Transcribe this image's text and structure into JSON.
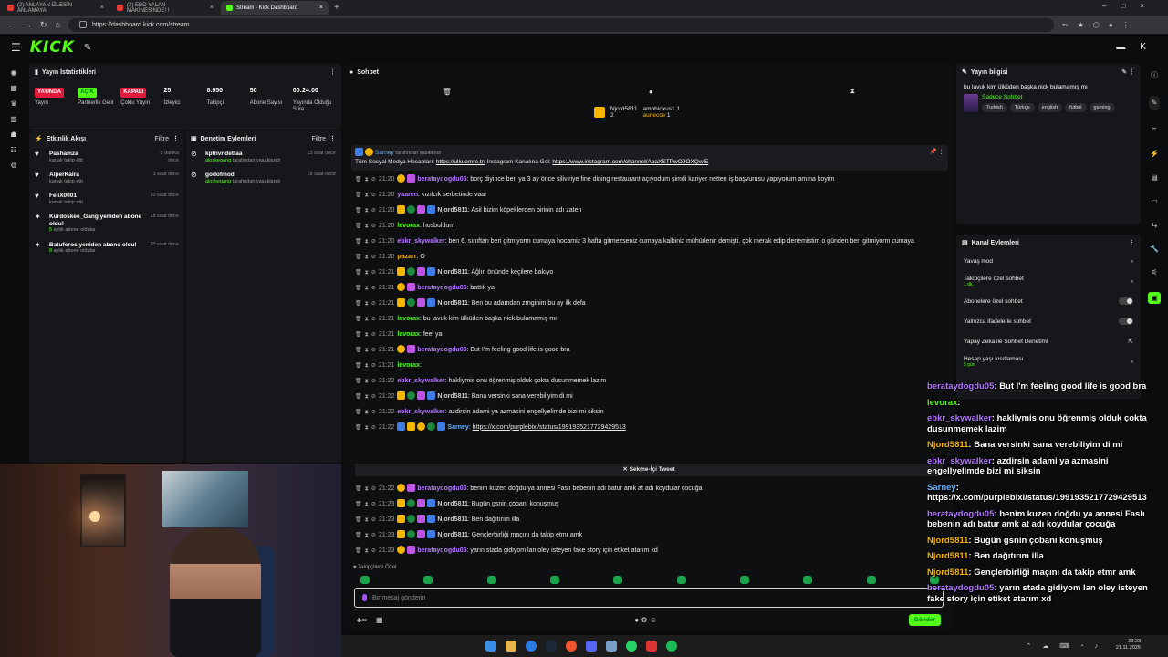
{
  "browser": {
    "tabs": [
      {
        "label": "(2) ANLAYAN İZLESİN ANLAMAYA",
        "active": false
      },
      {
        "label": "(2) EBO YALAN MAKİNESİNDE! !",
        "active": false
      },
      {
        "label": "Stream - Kick Dashboard",
        "active": true
      }
    ],
    "url": "https://dashboard.kick.com/stream"
  },
  "header": {
    "logo": "KICK"
  },
  "stats": {
    "title": "Yayın İstatistikleri",
    "items": [
      {
        "value": "YAYINDA",
        "label": "Yayın"
      },
      {
        "value": "AÇIK",
        "label": "Partnerlik Gelir"
      },
      {
        "value": "KAPALI",
        "label": "Çoklu Yayın"
      },
      {
        "value": "25",
        "label": "İzleyici"
      },
      {
        "value": "8.950",
        "label": "Takipçi"
      },
      {
        "value": "50",
        "label": "Abone Sayısı"
      },
      {
        "value": "00:24:00",
        "label": "Yayında Olduğu Süre"
      }
    ]
  },
  "activity": {
    "title": "Etkinlik Akışı",
    "filter": "Filtre",
    "items": [
      {
        "name": "Pashamza",
        "sub": "kanalı takip etti",
        "time": "8 dakika önce"
      },
      {
        "name": "AlperKaira",
        "sub": "kanalı takip etti",
        "time": "3 saat önce"
      },
      {
        "name": "FeliX0001",
        "sub": "kanalı takip etti",
        "time": "10 saat önce"
      },
      {
        "name": "Kurdoskee_Gang yeniden abone oldu!",
        "count": "5",
        "sub": "aylık abone oldular",
        "time": "18 saat önce"
      },
      {
        "name": "Batuforos yeniden abone oldu!",
        "count": "8",
        "sub": "aylık abone oldular",
        "time": "20 saat önce"
      }
    ]
  },
  "audit": {
    "title": "Denetim Eylemleri",
    "filter": "Filtre",
    "items": [
      {
        "name": "kptnvndettaa",
        "by": "aloskegang",
        "sub": "tarafından yasaklandı",
        "time": "13 saat önce"
      },
      {
        "name": "godofmod",
        "by": "aloskegang",
        "sub": "tarafından yasaklandı",
        "time": "19 saat önce"
      }
    ]
  },
  "chat": {
    "title": "Sohbet",
    "top": [
      {
        "name": "Njord5811",
        "count": "2"
      },
      {
        "name": "amphioxus1",
        "count": "1"
      },
      {
        "name": "auriecce",
        "count": "1"
      }
    ],
    "pinned": {
      "user": "Sarney",
      "by_text": "tarafından sabitlendi",
      "text": "Tüm Sosyal Medya Hesapları: ",
      "link1": "https://ulkuemre.tr/",
      "mid": " Instagram Kanalına Gel: ",
      "link2": "https://www.instagram.com/channel/AbaXSTPwO9OXQwlE"
    },
    "messages": [
      {
        "time": "21:20",
        "user": "berataydogdu05",
        "color": "#b479ff",
        "text": "borç diyince ben ya 3 ay önce siliviriye fine dining restaurant açıyodum şimdi kariyer netten iş başvurusu yapıyorum amına koyim"
      },
      {
        "time": "21:20",
        "user": "yaaren",
        "color": "#b479ff",
        "text": "kızılcık serbetinde vaar"
      },
      {
        "time": "21:20",
        "user": "Njord5811",
        "color": "#cfcfcf",
        "text": "Asil bizim köpeklerden birinin adı zaten"
      },
      {
        "time": "21:20",
        "user": "levorax",
        "color": "#53fc18",
        "text": "hosbuldum"
      },
      {
        "time": "21:20",
        "user": "ebkr_skywalker",
        "color": "#b479ff",
        "text": "ben 6. sınıftan beri gitmiyorm cumaya hocamiz 3 hafta gitmezseniz cumaya kalbiniz mühürlenir demişti. çok merak edip denemistim o günden beri gitmiyorm cumaya"
      },
      {
        "time": "21:20",
        "user": "pazarr",
        "color": "#f4b400",
        "text": "O"
      },
      {
        "time": "21:21",
        "user": "Njord5811",
        "color": "#cfcfcf",
        "text": "Ağlın önünde keçilere bakıyo"
      },
      {
        "time": "21:21",
        "user": "berataydogdu05",
        "color": "#b479ff",
        "text": "battık ya"
      },
      {
        "time": "21:21",
        "user": "Njord5811",
        "color": "#cfcfcf",
        "text": "Ben bu adamdan zrnginim bu ay ilk defa"
      },
      {
        "time": "21:21",
        "user": "levorax",
        "color": "#53fc18",
        "text": "bu lavuk kim ülküden başka nick bulamamış mı"
      },
      {
        "time": "21:21",
        "user": "levorax",
        "color": "#53fc18",
        "text": "feel ya"
      },
      {
        "time": "21:21",
        "user": "berataydogdu05",
        "color": "#b479ff",
        "text": "But I'm feeling good life is good bra"
      },
      {
        "time": "21:21",
        "user": "levorax",
        "color": "#53fc18",
        "text": ""
      },
      {
        "time": "21:22",
        "user": "ebkr_skywalker",
        "color": "#b479ff",
        "text": "hakliymis onu öğrenmiş olduk çokta dusunmemek lazim"
      },
      {
        "time": "21:22",
        "user": "Njord5811",
        "color": "#cfcfcf",
        "text": "Bana versinki sana verebiliyim di mi"
      },
      {
        "time": "21:22",
        "user": "ebkr_skywalker",
        "color": "#b479ff",
        "text": "azdirsin adami ya azmasini engellyelimde bizi mi siksin"
      },
      {
        "time": "21:22",
        "user": "Sarney",
        "color": "#66b3ff",
        "text": "",
        "link": "https://x.com/purplebixi/status/1991935217729429513"
      }
    ],
    "tweet_label": "Sekme-İçi Tweet",
    "messages2": [
      {
        "time": "21:22",
        "user": "berataydogdu05",
        "color": "#b479ff",
        "text": "benim kuzen doğdu ya annesi Faslı bebenin adı batur amk at adı koydular çocuğa"
      },
      {
        "time": "21:23",
        "user": "Njord5811",
        "color": "#cfcfcf",
        "text": "Bugün gsnin çobanı konuşmuş"
      },
      {
        "time": "21:23",
        "user": "Njord5811",
        "color": "#cfcfcf",
        "text": "Ben dağıtırım illa"
      },
      {
        "time": "21:23",
        "user": "Njord5811",
        "color": "#cfcfcf",
        "text": "Gençlerbirliği maçını da takip etmr amk"
      },
      {
        "time": "21:23",
        "user": "berataydogdu05",
        "color": "#b479ff",
        "text": "yarın stada gidiyom lan oley isteyen fake story için etiket atarım xd"
      }
    ],
    "emote_label": "Takipçilere Özel",
    "input_placeholder": "Bir mesaj gönderin",
    "send_label": "Gönder"
  },
  "info": {
    "title": "Yayın bilgisi",
    "stream_title": "bu lavuk kim ülküden başka nick bulamamış mı",
    "category": "Sadece Sohbet",
    "tags": [
      "Turkish",
      "Türkçe",
      "english",
      "futbol",
      "gaming"
    ]
  },
  "channel_actions": {
    "title": "Kanal Eylemleri",
    "items": [
      {
        "label": "Yavaş mod",
        "control": "arrow"
      },
      {
        "label": "Takipçilere özel sohbet",
        "sub": "1 dk.",
        "control": "arrow"
      },
      {
        "label": "Abonelere özel sohbet",
        "control": "toggle"
      },
      {
        "label": "Yalnızca ifadelerle sohbet",
        "control": "toggle"
      },
      {
        "label": "Yapay Zeka ile Sohbet Denetimi",
        "control": "external"
      },
      {
        "label": "Hesap yaşı kısıtlaması",
        "sub": "5 gün",
        "control": "arrow"
      }
    ]
  },
  "overlay": [
    {
      "user": "berataydogdu05",
      "cls": "op",
      "text": ": But I'm feeling good life is good bra"
    },
    {
      "user": "levorax",
      "cls": "oy",
      "text": ":"
    },
    {
      "user": "ebkr_skywalker",
      "cls": "op",
      "text": ": hakliymis onu öğrenmiş olduk çokta dusunmemek lazim"
    },
    {
      "user": "Njord5811",
      "cls": "on",
      "text": ": Bana versinki sana verebiliyim di mi"
    },
    {
      "user": "ebkr_skywalker",
      "cls": "op",
      "text": ": azdirsin adami ya azmasini engellyelimde bizi mi siksin"
    },
    {
      "user": "Sarney",
      "cls": "ob",
      "text": ": https://x.com/purplebixi/status/1991935217729429513"
    },
    {
      "user": "berataydogdu05",
      "cls": "op",
      "text": ": benim kuzen doğdu ya annesi Faslı bebenin adı batur amk at adı koydular çocuğa"
    },
    {
      "user": "Njord5811",
      "cls": "on",
      "text": ": Bugün gsnin çobanı konuşmuş"
    },
    {
      "user": "Njord5811",
      "cls": "on",
      "text": ": Ben dağıtırım illa"
    },
    {
      "user": "Njord5811",
      "cls": "on",
      "text": ": Gençlerbirliği maçını da takip etmr amk"
    },
    {
      "user": "berataydogdu05",
      "cls": "op",
      "text": ": yarın stada gidiyom lan oley isteyen fake story için etiket atarım xd"
    }
  ],
  "taskbar": {
    "time": "23:23",
    "date": "21.11.2025"
  }
}
